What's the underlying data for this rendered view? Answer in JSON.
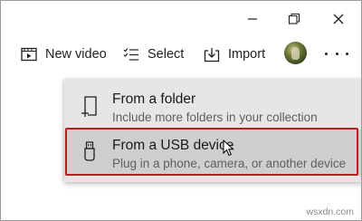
{
  "window_controls": {
    "minimize_icon": "minimize-icon",
    "maximize_icon": "restore-icon",
    "close_icon": "close-icon"
  },
  "toolbar": {
    "new_video_label": "New video",
    "select_label": "Select",
    "import_label": "Import",
    "more_icon": "more-dots-icon"
  },
  "import_menu": {
    "items": [
      {
        "title": "From a folder",
        "subtitle": "Include more folders in your collection",
        "icon": "folder-add-icon"
      },
      {
        "title": "From a USB device",
        "subtitle": "Plug in a phone, camera, or another device",
        "icon": "usb-icon"
      }
    ]
  },
  "watermark": "wsxdn.com",
  "colors": {
    "menu_bg": "#e6e6e6",
    "menu_hover_bg": "#cfcfcf",
    "highlight_border": "#b82020"
  }
}
